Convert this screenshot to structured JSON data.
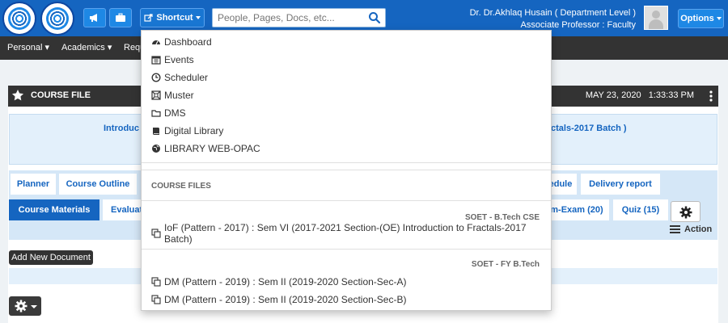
{
  "header": {
    "shortcut_label": "Shortcut",
    "search_placeholder": "People, Pages, Docs, etc...",
    "user_name": "Dr. Dr.Akhlaq Husain ( Department Level )",
    "user_role": "Associate Professor : Faculty",
    "options_label": "Options"
  },
  "nav": {
    "items": [
      "Personal",
      "Academics",
      "Requ"
    ]
  },
  "panel": {
    "title": "COURSE FILE",
    "datetime": "MAY 23, 2020   1:33:33 PM",
    "course_left": "Introduc",
    "course_right": "ctals-2017 Batch )"
  },
  "tabs": {
    "row1": [
      "Planner",
      "Course Outline",
      "edule",
      "Delivery report"
    ],
    "row2": [
      "Course Materials",
      "Evaluat",
      "m-Exam (20)",
      "Quiz (15)"
    ],
    "action_label": "Action"
  },
  "add_doc_tooltip": "Add New Document",
  "shortcut_menu": {
    "items": [
      {
        "label": "Dashboard",
        "icon": "dashboard-icon"
      },
      {
        "label": "Events",
        "icon": "calendar-icon"
      },
      {
        "label": "Scheduler",
        "icon": "clock-icon"
      },
      {
        "label": "Muster",
        "icon": "muster-icon"
      },
      {
        "label": "DMS",
        "icon": "folder-icon"
      },
      {
        "label": "Digital Library",
        "icon": "book-icon"
      },
      {
        "label": "LIBRARY WEB-OPAC",
        "icon": "globe-icon"
      }
    ],
    "course_files_header": "COURSE FILES",
    "groups": [
      {
        "label": "SOET - B.Tech CSE",
        "files": [
          "IoF (Pattern - 2017) : Sem VI (2017-2021 Section-(OE) Introduction to Fractals-2017 Batch)"
        ]
      },
      {
        "label": "SOET - FY B.Tech",
        "files": [
          "DM (Pattern - 2019) : Sem II (2019-2020 Section-Sec-A)",
          "DM (Pattern - 2019) : Sem II (2019-2020 Section-Sec-B)"
        ]
      }
    ]
  },
  "colors": {
    "topbar": "#1565c0",
    "navbar": "#333333",
    "accent": "#1565c0"
  }
}
